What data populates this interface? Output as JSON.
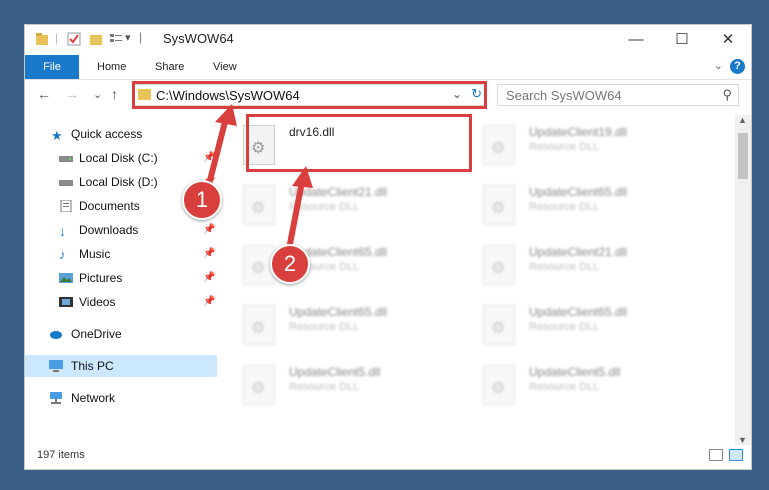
{
  "window": {
    "title": "SysWOW64",
    "controls": {
      "minimize": "—",
      "maximize": "☐",
      "close": "✕"
    }
  },
  "ribbon": {
    "tabs": [
      "File",
      "Home",
      "Share",
      "View"
    ],
    "help": "?",
    "expand": "⌄"
  },
  "address": {
    "path": "C:\\Windows\\SysWOW64",
    "dropdown": "⌄",
    "refresh": "↻"
  },
  "nav": {
    "back": "←",
    "forward": "→",
    "recent": "⌄",
    "up": "↑"
  },
  "search": {
    "placeholder": "Search SysWOW64",
    "icon": "⚲"
  },
  "sidebar": {
    "items": [
      {
        "label": "Quick access",
        "icon": "star-icon"
      },
      {
        "label": "Local Disk (C:)",
        "icon": "drive-icon",
        "pinned": true
      },
      {
        "label": "Local Disk (D:)",
        "icon": "drive-icon",
        "pinned": true
      },
      {
        "label": "Documents",
        "icon": "documents-icon",
        "pinned": true
      },
      {
        "label": "Downloads",
        "icon": "downloads-icon",
        "pinned": true
      },
      {
        "label": "Music",
        "icon": "music-icon",
        "pinned": true
      },
      {
        "label": "Pictures",
        "icon": "pictures-icon",
        "pinned": true
      },
      {
        "label": "Videos",
        "icon": "videos-icon",
        "pinned": true
      },
      {
        "label": "OneDrive",
        "icon": "cloud-icon"
      },
      {
        "label": "This PC",
        "icon": "computer-icon",
        "selected": true
      },
      {
        "label": "Network",
        "icon": "network-icon"
      }
    ]
  },
  "files": [
    {
      "name": "drv16.dll",
      "type": ""
    },
    {
      "name": "UpdateClient19.dll",
      "type": "Resource DLL"
    },
    {
      "name": "UpdateClient21.dll",
      "type": "Resource DLL"
    },
    {
      "name": "UpdateClient65.dll",
      "type": "Resource DLL"
    },
    {
      "name": "UpdateClient65.dll",
      "type": "Resource DLL"
    },
    {
      "name": "UpdateClient21.dll",
      "type": "Resource DLL"
    },
    {
      "name": "UpdateClient65.dll",
      "type": "Resource DLL"
    },
    {
      "name": "UpdateClient65.dll",
      "type": "Resource DLL"
    },
    {
      "name": "UpdateClient5.dll",
      "type": "Resource DLL"
    },
    {
      "name": "UpdateClient5.dll",
      "type": "Resource DLL"
    }
  ],
  "status": {
    "count": "197 items"
  },
  "callouts": [
    "1",
    "2"
  ],
  "colors": {
    "accent": "#1979ca",
    "highlight": "#d9403d",
    "selection": "#cce8ff"
  }
}
